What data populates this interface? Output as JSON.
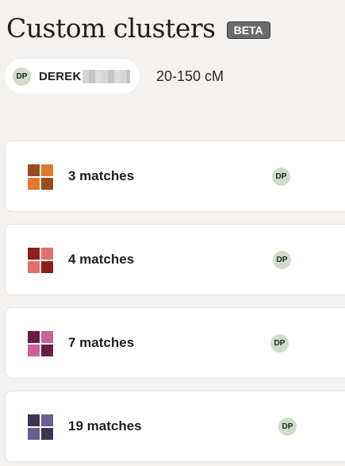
{
  "page": {
    "title": "Custom clusters",
    "badge": "BETA"
  },
  "filter": {
    "person": {
      "initials": "DP",
      "name": "DEREK"
    },
    "range": "20-150 cM"
  },
  "clusters": [
    {
      "label": "3 matches",
      "initials": "DP",
      "colors": [
        "#9b4a1c",
        "#e07a2e",
        "#e07a2e",
        "#9b4a1c"
      ]
    },
    {
      "label": "4 matches",
      "initials": "DP",
      "colors": [
        "#8a1f1c",
        "#e0706a",
        "#e0706a",
        "#8a1f1c"
      ]
    },
    {
      "label": "7 matches",
      "initials": "DP",
      "colors": [
        "#6b1d45",
        "#c9619a",
        "#c9619a",
        "#6b1d45"
      ]
    },
    {
      "label": "19 matches",
      "initials": "DP",
      "colors": [
        "#3d3550",
        "#6c5c93",
        "#6c5c93",
        "#3d3550"
      ]
    }
  ]
}
